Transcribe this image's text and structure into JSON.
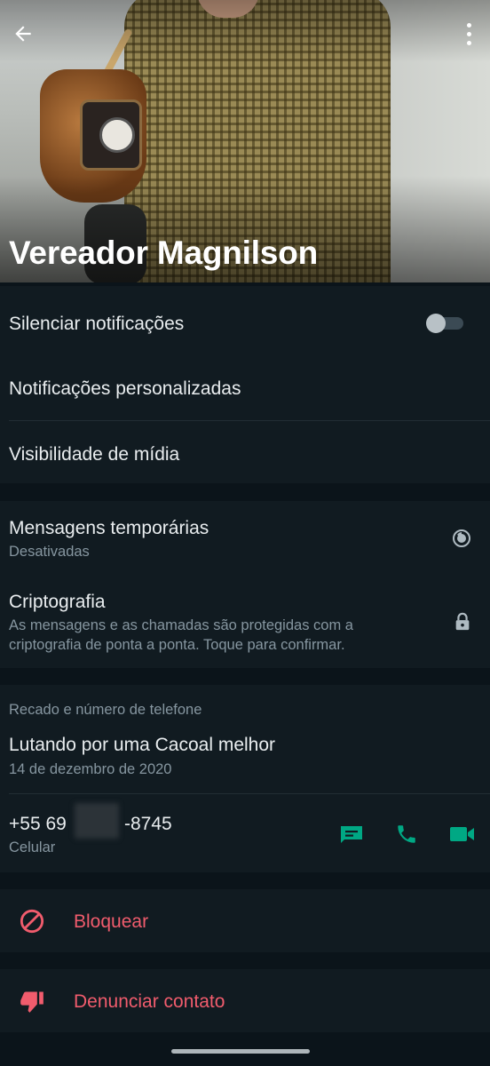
{
  "header": {
    "contact_name": "Vereador Magnilson"
  },
  "notifications": {
    "mute_label": "Silenciar notificações",
    "mute_enabled": false,
    "custom_label": "Notificações personalizadas",
    "media_label": "Visibilidade de mídia"
  },
  "privacy": {
    "temp_title": "Mensagens temporárias",
    "temp_status": "Desativadas",
    "crypto_title": "Criptografia",
    "crypto_line1": "As mensagens e as chamadas são protegidas com a",
    "crypto_line2": "criptografia de ponta a ponta. Toque para confirmar."
  },
  "about": {
    "section_title": "Recado e número de telefone",
    "status_text": "Lutando por uma Cacoal melhor",
    "status_date": "14 de dezembro de 2020",
    "phone_prefix": "+55 69",
    "phone_suffix": "-8745",
    "phone_type": "Celular"
  },
  "actions": {
    "block_label": "Bloquear",
    "report_label": "Denunciar contato"
  },
  "colors": {
    "accent": "#00a884",
    "danger": "#f15c6d",
    "background": "#0b141a",
    "surface": "#111b21"
  }
}
